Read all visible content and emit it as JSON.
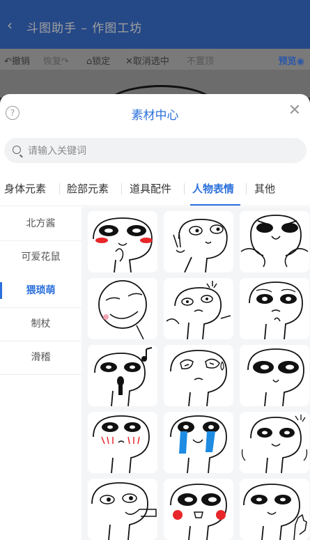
{
  "header": {
    "back_icon": "back-arrow-icon",
    "title": "斗图助手 – 作图工坊"
  },
  "toolbar": {
    "undo": "撤销",
    "redo": "恢复",
    "lock": "锁定",
    "deselect": "取消选中",
    "unchanged": "不置顶",
    "preview": "预览"
  },
  "sheet": {
    "title": "素材中心",
    "help_icon": "help-circle-icon",
    "close_icon": "close-icon",
    "search_placeholder": "请输入关键词"
  },
  "tabs": [
    {
      "label": "身体元素",
      "active": false
    },
    {
      "label": "脸部元素",
      "active": false
    },
    {
      "label": "道具配件",
      "active": false
    },
    {
      "label": "人物表情",
      "active": true
    },
    {
      "label": "其他",
      "active": false
    }
  ],
  "side": [
    {
      "label": "北方酱",
      "active": false
    },
    {
      "label": "可爱花鼠",
      "active": false
    },
    {
      "label": "猥琐萌",
      "active": true
    },
    {
      "label": "制杖",
      "active": false
    },
    {
      "label": "滑稽",
      "active": false
    }
  ],
  "stickers": [
    "sticker-blush-hand",
    "sticker-peace-sign",
    "sticker-angry-shrug",
    "sticker-smug-face",
    "sticker-angry-point",
    "sticker-thinking",
    "sticker-singing-mic",
    "sticker-scared-sweat",
    "sticker-wide-eyes",
    "sticker-embarrassed",
    "sticker-crying",
    "sticker-shocked",
    "sticker-pointing",
    "sticker-blush-smile",
    "sticker-waving"
  ]
}
